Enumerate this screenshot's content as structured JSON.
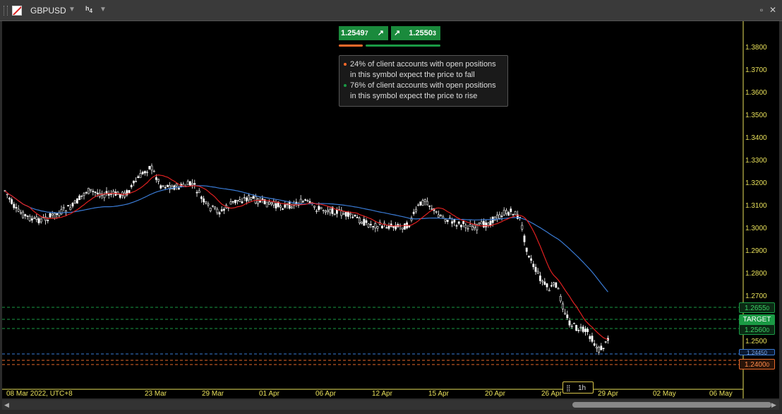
{
  "toolbar": {
    "symbol": "GBPUSD",
    "timeframe_main": "h",
    "timeframe_sub": "4"
  },
  "prices": {
    "bid_main": "1.2549",
    "bid_small": "7",
    "ask_main": "1.2550",
    "ask_small": "3"
  },
  "sentiment": {
    "sell_line1": "24% of client accounts with open positions",
    "sell_line2": "in this symbol expect the price to fall",
    "buy_line1": "76% of client accounts with open positions",
    "buy_line2": "in this symbol expect the price to rise",
    "sell_pct": 24,
    "buy_pct": 76,
    "sell_color": "#ff6a2a",
    "buy_color": "#1a9a44"
  },
  "levels": {
    "green_top": "1.2655",
    "green_top_small": "0",
    "target": "TARGET",
    "green_bottom": "1.2560",
    "green_bottom_small": "0",
    "blue": "1.2445",
    "blue_small": "0",
    "orange": "1.2400",
    "orange_small": "0"
  },
  "y_axis": [
    "1.3800",
    "1.3700",
    "1.3600",
    "1.3500",
    "1.3400",
    "1.3300",
    "1.3200",
    "1.3100",
    "1.3000",
    "1.2900",
    "1.2800",
    "1.2700",
    "1.2500"
  ],
  "x_axis": {
    "first": "08 Mar 2022, UTC+8",
    "labels": [
      "23 Mar",
      "29 Mar",
      "01 Apr",
      "06 Apr",
      "12 Apr",
      "15 Apr",
      "20 Apr",
      "26 Apr",
      "29 Apr",
      "02 May",
      "06 May"
    ]
  },
  "timeframe_box": "1h",
  "colors": {
    "candle": "#ffffff",
    "ma_fast": "#e02020",
    "ma_slow": "#3a7bd5",
    "axis_text": "#e8e05a",
    "level_green": "#1a9a44",
    "level_blue": "#3a7bd5",
    "level_orange": "#e86a2a"
  }
}
